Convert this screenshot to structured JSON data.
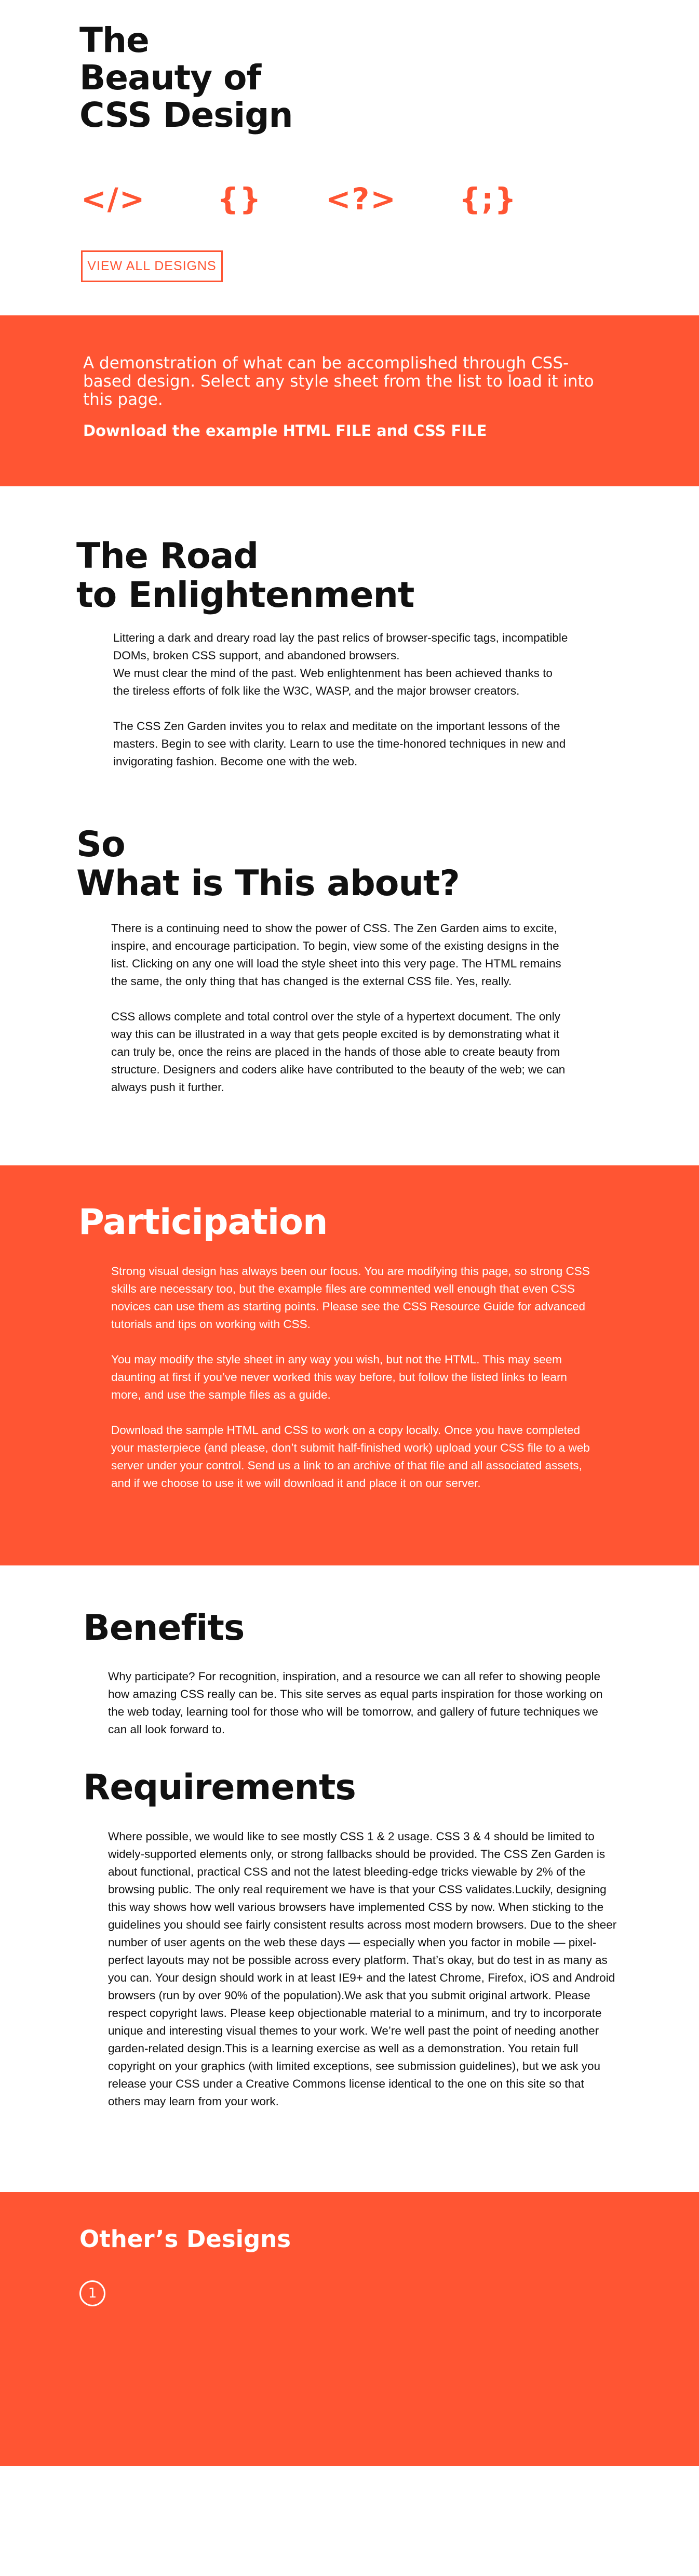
{
  "header": {
    "title_lines": [
      "The",
      "Beauty of",
      "CSS Design"
    ],
    "icons": [
      {
        "glyph": "</>",
        "name": "html-tag-icon"
      },
      {
        "glyph": "{}",
        "name": "curly-braces-icon"
      },
      {
        "glyph": "<?>",
        "name": "php-tag-icon"
      },
      {
        "glyph": "{;}",
        "name": "code-block-icon"
      }
    ],
    "view_all_label": "VIEW ALL DESIGNS"
  },
  "intro": {
    "summary": "A demonstration of what can be accomplished through CSS-based design. Select any style sheet from the list to load it into this page.",
    "download_prefix": "Download the example ",
    "html_link": "HTML FILE",
    "download_middle": " and ",
    "css_link": "CSS FILE"
  },
  "road": {
    "title_lines": [
      "The Road",
      "to Enlightenment"
    ],
    "paragraphs": [
      "Littering a dark and dreary road lay the past relics of browser-specific tags, incompatible DOMs, broken CSS support, and abandoned browsers.",
      "We must clear the mind of the past. Web enlightenment has been achieved thanks to the tireless efforts of folk like the W3C, WASP, and the major browser creators.",
      "The CSS Zen Garden invites you to relax and meditate on the important lessons of the masters. Begin to see with clarity. Learn to use the time-honored techniques in new and invigorating fashion. Become one with the web."
    ]
  },
  "about": {
    "title_lines": [
      "So",
      "What is This about?"
    ],
    "paragraphs": [
      "There is a continuing need to show the power of CSS. The Zen Garden aims to excite, inspire, and encourage participation. To begin, view some of the existing designs in the list. Clicking on any one will load the style sheet into this very page. The HTML remains the same, the only thing that has changed is the external CSS file. Yes, really.",
      "CSS allows complete and total control over the style of a hypertext document. The only way this can be illustrated in a way that gets people excited is by demonstrating what it can truly be, once the reins are placed in the hands of those able to create beauty from structure. Designers and coders alike have contributed to the beauty of the web; we can always push it further."
    ]
  },
  "participation": {
    "title": "Participation",
    "paragraphs": [
      "Strong visual design has always been our focus. You are modifying this page, so strong CSS skills are necessary too, but the example files are commented well enough that even CSS novices can use them as starting points. Please see the CSS Resource Guide for advanced tutorials and tips on working with CSS.",
      "You may modify the style sheet in any way you wish, but not the HTML. This may seem daunting at first if you’ve never worked this way before, but follow the listed links to learn more, and use the sample files as a guide.",
      "Download the sample HTML and CSS to work on a copy locally. Once you have completed your masterpiece (and please, don’t submit half-finished work) upload your CSS file to a web server under your control. Send us a link to an archive of that file and all associated assets, and if we choose to use it we will download it and place it on our server."
    ]
  },
  "benefits": {
    "title": "Benefits",
    "paragraph": "Why participate? For recognition, inspiration, and a resource we can all refer to showing people how amazing CSS really can be. This site serves as equal parts inspiration for those working on the web today, learning tool for those who will be tomorrow, and gallery of future techniques we can all look forward to."
  },
  "requirements": {
    "title": "Requirements",
    "paragraph": "Where possible, we would like to see mostly CSS 1 & 2 usage. CSS 3 & 4 should be limited to widely-supported elements only, or strong fallbacks should be provided. The CSS Zen Garden is about functional, practical CSS and not the latest bleeding-edge tricks viewable by 2% of the browsing public. The only real requirement we have is that your CSS validates.Luckily, designing this way shows how well various browsers have implemented CSS by now. When sticking to the guidelines you should see fairly consistent results across most modern browsers. Due to the sheer number of user agents on the web these days — especially when you factor in mobile — pixel-perfect layouts may not be possible across every platform. That’s okay, but do test in as many as you can. Your design should work in at least IE9+ and the latest Chrome, Firefox, iOS and Android browsers (run by over 90% of the population).We ask that you submit original artwork. Please respect copyright laws. Please keep objectionable material to a minimum, and try to incorporate unique and interesting visual themes to your work. We’re well past the point of needing another garden-related design.This is a learning exercise as well as a demonstration. You retain full copyright on your graphics (with limited exceptions, see submission guidelines), but we ask you release your CSS under a Creative Commons license identical to the one on this site so that others may learn from your work."
  },
  "others": {
    "title": "Other’s Designs",
    "page_number": "1"
  },
  "colors": {
    "accent": "#ff5533",
    "text": "#111111",
    "background": "#ffffff"
  }
}
